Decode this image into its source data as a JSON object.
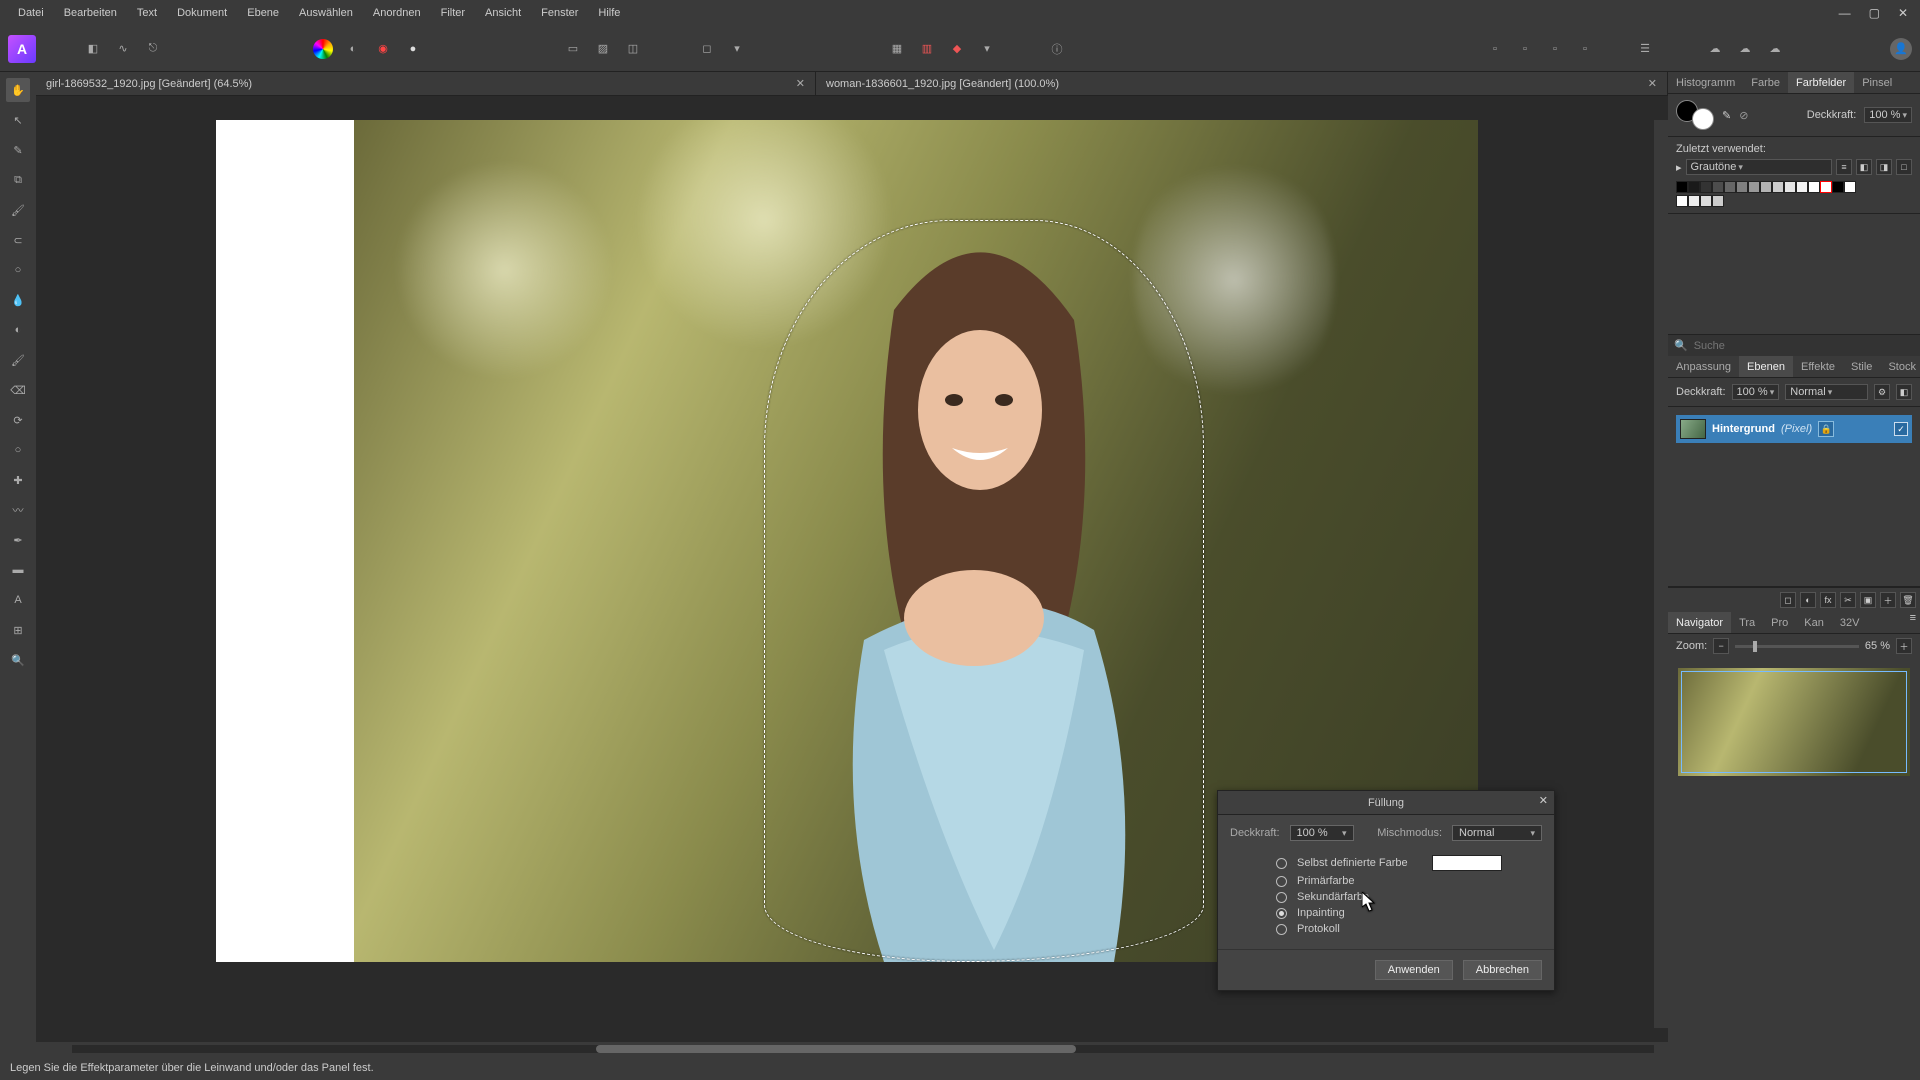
{
  "menu": {
    "items": [
      "Datei",
      "Bearbeiten",
      "Text",
      "Dokument",
      "Ebene",
      "Auswählen",
      "Anordnen",
      "Filter",
      "Ansicht",
      "Fenster",
      "Hilfe"
    ]
  },
  "tabs": [
    {
      "title": "girl-1869532_1920.jpg [Geändert] (64.5%)"
    },
    {
      "title": "woman-1836601_1920.jpg [Geändert] (100.0%)"
    }
  ],
  "right": {
    "tabs1": [
      "Histogramm",
      "Farbe",
      "Farbfelder",
      "Pinsel"
    ],
    "active1": 2,
    "opacity_label": "Deckkraft:",
    "opacity_value": "100 %",
    "recent_label": "Zuletzt verwendet:",
    "preset": "Grautöne",
    "search": "Suche",
    "tabs2": [
      "Anpassung",
      "Ebenen",
      "Effekte",
      "Stile",
      "Stock"
    ],
    "active2": 1,
    "blend_label": "Normal",
    "layer_name": "Hintergrund",
    "layer_kind": "(Pixel)",
    "tabs3": [
      "Navigator",
      "Tra",
      "Pro",
      "Kan",
      "32V"
    ],
    "active3": 0,
    "zoom_label": "Zoom:",
    "zoom_value": "65 %"
  },
  "dialog": {
    "title": "Füllung",
    "opacity_label": "Deckkraft:",
    "opacity_value": "100 %",
    "blend_label": "Mischmodus:",
    "blend_value": "Normal",
    "options": [
      "Selbst definierte Farbe",
      "Primärfarbe",
      "Sekundärfarbe",
      "Inpainting",
      "Protokoll"
    ],
    "selected": 3,
    "apply": "Anwenden",
    "cancel": "Abbrechen"
  },
  "status": "Legen Sie die Effektparameter über die Leinwand und/oder das Panel fest."
}
